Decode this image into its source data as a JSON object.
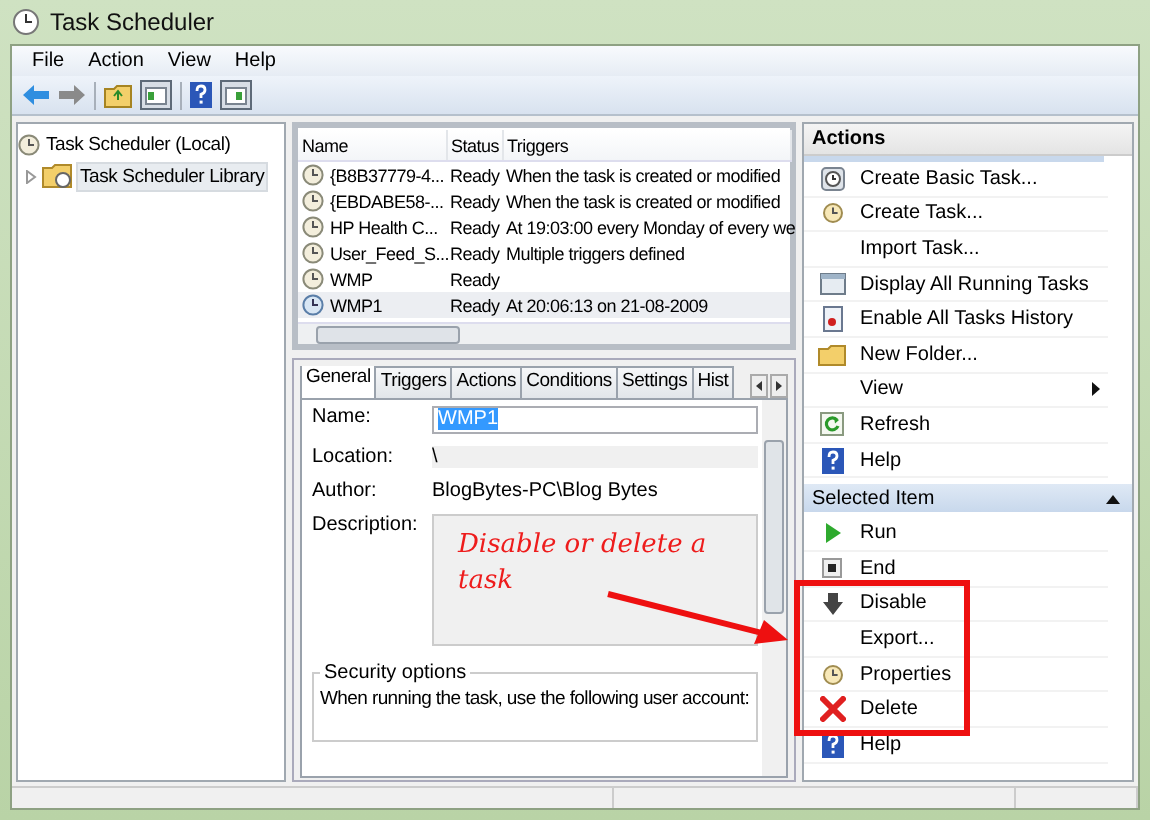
{
  "window": {
    "title": "Task Scheduler"
  },
  "menu": [
    {
      "label": "File"
    },
    {
      "label": "Action"
    },
    {
      "label": "View"
    },
    {
      "label": "Help"
    }
  ],
  "tree": [
    {
      "label": "Task Scheduler (Local)",
      "selected": false,
      "expanded": true,
      "children": [
        {
          "label": "Task Scheduler Library",
          "selected": true,
          "expanded": false
        }
      ]
    }
  ],
  "task_list": {
    "columns": [
      "Name",
      "Status",
      "Triggers"
    ],
    "rows": [
      {
        "name": "{B8B37779-4...",
        "status": "Ready",
        "triggers": "When the task is created or modified",
        "selected": false
      },
      {
        "name": "{EBDABE58-...",
        "status": "Ready",
        "triggers": "When the task is created or modified",
        "selected": false
      },
      {
        "name": "HP Health C...",
        "status": "Ready",
        "triggers": "At 19:03:00 every Monday of every we",
        "selected": false
      },
      {
        "name": "User_Feed_S...",
        "status": "Ready",
        "triggers": "Multiple triggers defined",
        "selected": false
      },
      {
        "name": "WMP",
        "status": "Ready",
        "selected": false
      },
      {
        "name": "WMP1",
        "status": "Ready",
        "triggers": "At 20:06:13 on 21-08-2009",
        "selected": true
      }
    ]
  },
  "details": {
    "tabs": [
      {
        "label": "General",
        "selected": true
      },
      {
        "label": "Triggers",
        "selected": false
      },
      {
        "label": "Actions",
        "selected": false
      },
      {
        "label": "Conditions",
        "selected": false
      },
      {
        "label": "Settings",
        "selected": false
      },
      {
        "label": "Hist",
        "selected": false
      }
    ],
    "fields": [
      {
        "label": "Name:",
        "value": "WMP1",
        "kind": "input"
      },
      {
        "label": "Location:",
        "value": "\\",
        "kind": "readonly"
      },
      {
        "label": "Author:",
        "value": "BlogBytes-PC\\Blog Bytes",
        "kind": "plain"
      },
      {
        "label": "Description:",
        "kind": "textarea"
      }
    ],
    "security": {
      "title": "Security options",
      "text": "When running the task, use the following user account:"
    }
  },
  "actions": {
    "title": "Actions",
    "sections": [
      {
        "items": [
          {
            "label": "Create Basic Task...",
            "submenu": false
          },
          {
            "label": "Create Task...",
            "submenu": false
          },
          {
            "label": "Import Task...",
            "submenu": false
          },
          {
            "label": "Display All Running Tasks",
            "submenu": false
          },
          {
            "label": "Enable All Tasks History",
            "submenu": false
          },
          {
            "label": "New Folder...",
            "submenu": false
          },
          {
            "label": "View",
            "submenu": true
          },
          {
            "label": "Refresh",
            "submenu": false
          },
          {
            "label": "Help",
            "submenu": false
          }
        ]
      },
      {
        "title": "Selected Item",
        "items": [
          {
            "label": "Run",
            "submenu": false
          },
          {
            "label": "End",
            "submenu": false
          },
          {
            "label": "Disable",
            "submenu": false
          },
          {
            "label": "Export...",
            "submenu": false
          },
          {
            "label": "Properties",
            "submenu": false
          },
          {
            "label": "Delete",
            "submenu": false
          },
          {
            "label": "Help",
            "submenu": false
          }
        ]
      }
    ]
  },
  "annotation": {
    "text": "Disable or delete a task"
  }
}
